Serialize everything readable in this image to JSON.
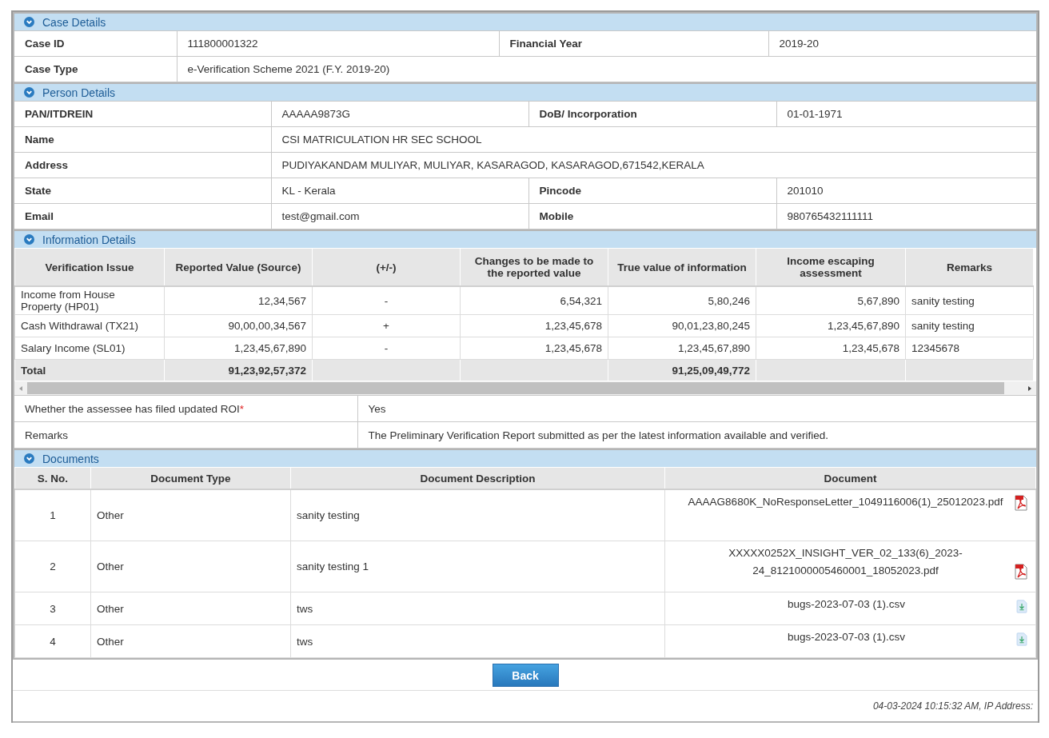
{
  "case_details": {
    "title": "Case Details",
    "rows": [
      {
        "cells": [
          {
            "label": "Case ID",
            "value": "111800001322"
          },
          {
            "label": "Financial Year",
            "value": "2019-20"
          }
        ]
      },
      {
        "cells": [
          {
            "label": "Case Type",
            "value": "e-Verification Scheme 2021 (F.Y. 2019-20)"
          }
        ]
      }
    ]
  },
  "person_details": {
    "title": "Person Details",
    "rows": [
      {
        "cells": [
          {
            "label": "PAN/ITDREIN",
            "value": "AAAAA9873G"
          },
          {
            "label": "DoB/ Incorporation",
            "value": "01-01-1971"
          }
        ]
      },
      {
        "cells": [
          {
            "label": "Name",
            "value": "CSI MATRICULATION HR SEC SCHOOL"
          }
        ]
      },
      {
        "cells": [
          {
            "label": "Address",
            "value": "PUDIYAKANDAM MULIYAR, MULIYAR, KASARAGOD, KASARAGOD,671542,KERALA"
          }
        ]
      },
      {
        "cells": [
          {
            "label": "State",
            "value": "KL - Kerala"
          },
          {
            "label": "Pincode",
            "value": "201010"
          }
        ]
      },
      {
        "cells": [
          {
            "label": "Email",
            "value": "test@gmail.com"
          },
          {
            "label": "Mobile",
            "value": "980765432111111"
          }
        ]
      }
    ]
  },
  "information_details": {
    "title": "Information Details",
    "columns": [
      "Verification Issue",
      "Reported Value (Source)",
      "(+/-)",
      "Changes to be made to the reported value",
      "True value of information",
      "Income escaping assessment",
      "Remarks"
    ],
    "rows": [
      {
        "issue": "Income from House Property (HP01)",
        "reported": "12,34,567",
        "sign": "-",
        "changes": "6,54,321",
        "true_value": "5,80,246",
        "escaping": "5,67,890",
        "remarks": "sanity testing"
      },
      {
        "issue": "Cash Withdrawal (TX21)",
        "reported": "90,00,00,34,567",
        "sign": "+",
        "changes": "1,23,45,678",
        "true_value": "90,01,23,80,245",
        "escaping": "1,23,45,67,890",
        "remarks": "sanity testing"
      },
      {
        "issue": "Salary Income (SL01)",
        "reported": "1,23,45,67,890",
        "sign": "-",
        "changes": "1,23,45,678",
        "true_value": "1,23,45,67,890",
        "escaping": "1,23,45,678",
        "remarks": "12345678"
      }
    ],
    "total": {
      "label": "Total",
      "reported": "91,23,92,57,372",
      "true_value": "91,25,09,49,772"
    },
    "extra": [
      {
        "label": "Whether the assessee has filed updated ROI",
        "required_mark": "*",
        "value": "Yes"
      },
      {
        "label": "Remarks",
        "value": "The Preliminary Verification Report submitted as per the latest information available and verified."
      }
    ]
  },
  "documents": {
    "title": "Documents",
    "columns": [
      "S. No.",
      "Document Type",
      "Document Description",
      "Document"
    ],
    "rows": [
      {
        "sno": "1",
        "type": "Other",
        "description": "sanity testing",
        "file": "AAAAG8680K_NoResponseLetter_1049116006(1)_25012023.pdf",
        "kind": "pdf"
      },
      {
        "sno": "2",
        "type": "Other",
        "description": "sanity testing 1",
        "file": "XXXXX0252X_INSIGHT_VER_02_133(6)_2023-24_8121000005460001_18052023.pdf",
        "kind": "pdf"
      },
      {
        "sno": "3",
        "type": "Other",
        "description": "tws",
        "file": "bugs-2023-07-03 (1).csv",
        "kind": "csv"
      },
      {
        "sno": "4",
        "type": "Other",
        "description": "tws",
        "file": "bugs-2023-07-03 (1).csv",
        "kind": "csv"
      }
    ]
  },
  "back_button": "Back",
  "footer": "04-03-2024 10:15:32 AM, IP Address:"
}
